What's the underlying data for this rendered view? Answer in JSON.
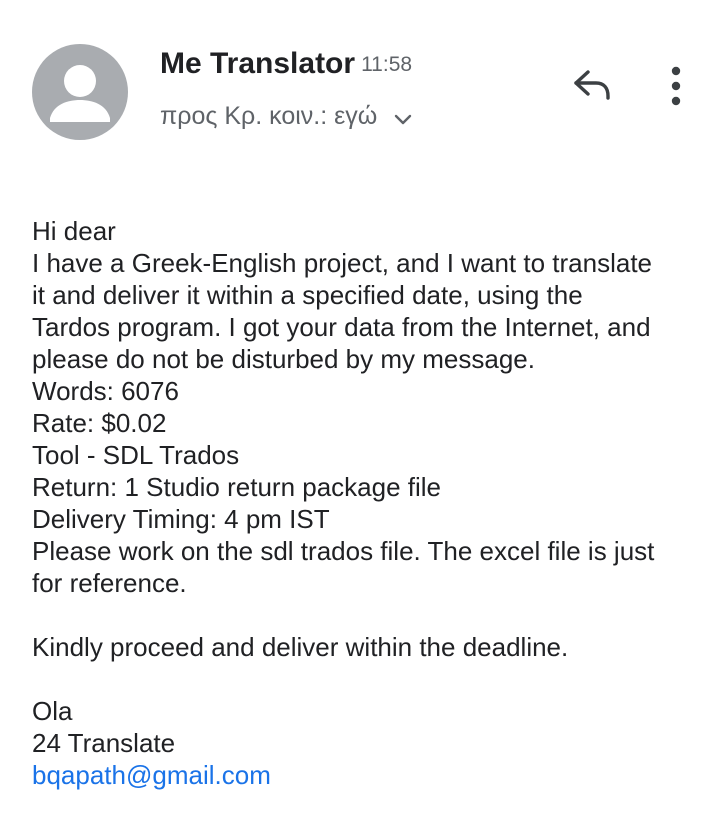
{
  "message": {
    "sender_name": "Me Translator",
    "time": "11:58",
    "recipients_text": "προς Κρ. κοιν.: εγώ",
    "icons": {
      "avatar": "person-icon",
      "expand": "chevron-down-icon",
      "reply": "reply-icon",
      "more": "more-vert-icon"
    }
  },
  "body": {
    "greeting": "Hi dear",
    "intro_lines": [
      "I have a Greek-English project, and I want to translate",
      "it and deliver it within a specified date, using the",
      "Tardos program. I got your data from the Internet, and",
      "please do not be disturbed by my message."
    ],
    "words": "Words: 6076",
    "rate": "Rate: $0.02",
    "tool": "Tool - SDL Trados",
    "return_line": "Return: 1 Studio return package file",
    "delivery": "Delivery Timing: 4 pm IST",
    "note_lines": [
      "Please work on the sdl trados file. The excel file is just",
      "for reference."
    ],
    "closing": "Kindly proceed and deliver within the deadline.",
    "signature_name": "Ola",
    "signature_company": "24 Translate",
    "signature_email": "bqapath@gmail.com"
  },
  "colors": {
    "link": "#1a73e8",
    "avatar_bg": "#a9acb0",
    "text_primary": "#202124",
    "text_secondary": "#5f6368"
  }
}
